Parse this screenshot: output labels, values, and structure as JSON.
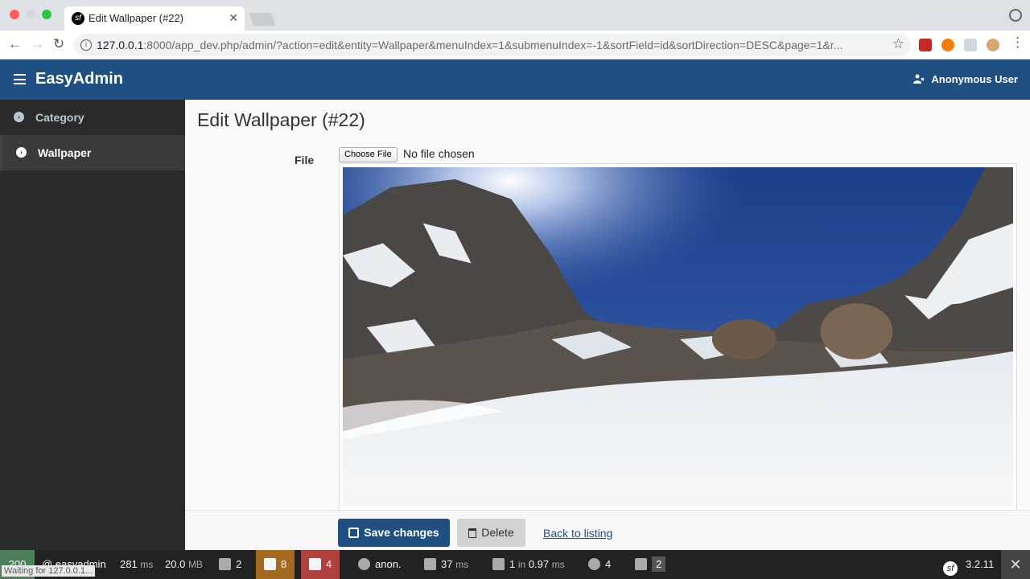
{
  "browser": {
    "tab_title": "Edit Wallpaper (#22)",
    "url_host": "127.0.0.1",
    "url_rest": ":8000/app_dev.php/admin/?action=edit&entity=Wallpaper&menuIndex=1&submenuIndex=-1&sortField=id&sortDirection=DESC&page=1&r...",
    "status_text": "Waiting for 127.0.0.1..."
  },
  "header": {
    "brand": "EasyAdmin",
    "user": "Anonymous User"
  },
  "sidebar": {
    "items": [
      {
        "label": "Category",
        "active": false
      },
      {
        "label": "Wallpaper",
        "active": true
      }
    ]
  },
  "main": {
    "title": "Edit Wallpaper (#22)",
    "file_label": "File",
    "file_button": "Choose File",
    "file_status": "No file chosen"
  },
  "actions": {
    "save": "Save changes",
    "delete": "Delete",
    "back": "Back to listing"
  },
  "profiler": {
    "status_code": "200",
    "route": "@ easyadmin",
    "time_value": "281",
    "time_unit": "ms",
    "memory_value": "20.0",
    "memory_unit": "MB",
    "logs_count": "2",
    "warnings_count": "8",
    "errors_count": "4",
    "user": "anon.",
    "render_time": "37",
    "render_unit": "ms",
    "db_queries": "1",
    "db_in": "in",
    "db_time": "0.97",
    "db_unit": "ms",
    "forms_count": "4",
    "debug_count": "2",
    "version": "3.2.11"
  },
  "colors": {
    "primary": "#205081",
    "sidebar": "#2a2a2a",
    "profiler_ok": "#4f805d",
    "profiler_warn": "#a46a1f",
    "profiler_error": "#b0413e"
  }
}
